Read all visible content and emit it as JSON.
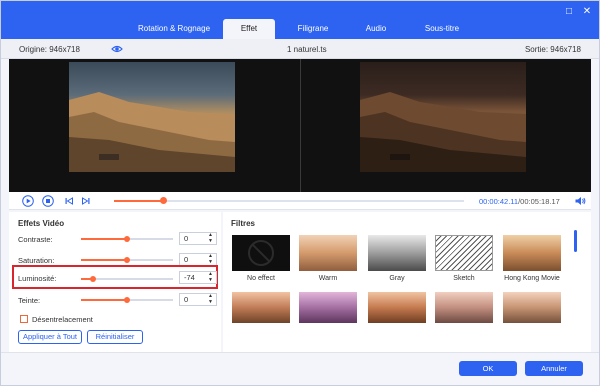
{
  "window": {
    "minimize_glyph": "□",
    "close_glyph": "✕"
  },
  "tabs": [
    {
      "label": "Rotation & Rognage",
      "active": false
    },
    {
      "label": "Effet",
      "active": true
    },
    {
      "label": "Filigrane",
      "active": false
    },
    {
      "label": "Audio",
      "active": false
    },
    {
      "label": "Sous-titre",
      "active": false
    }
  ],
  "infobar": {
    "source": "Origine: 946x718",
    "filename": "1 naturel.ts",
    "output": "Sortie: 946x718"
  },
  "playback": {
    "current_time": "00:00:42.11",
    "separator": "/",
    "total_time": "00:05:18.17",
    "progress_fraction": 0.14
  },
  "video_effects": {
    "title": "Effets Vidéo",
    "rows": [
      {
        "label": "Contraste:",
        "value": "0",
        "level": 0.5
      },
      {
        "label": "Saturation:",
        "value": "0",
        "level": 0.5
      },
      {
        "label": "Luminosité:",
        "value": "-74",
        "level": 0.13
      },
      {
        "label": "Teinte:",
        "value": "0",
        "level": 0.5
      }
    ],
    "deinterlace_label": "Désentrelacement",
    "apply_all_label": "Appliquer à Tout",
    "reset_label": "Réinitialiser"
  },
  "filters": {
    "title": "Filtres",
    "row1": [
      {
        "label": "No effect",
        "icon": "no-effect-icon"
      },
      {
        "label": "Warm"
      },
      {
        "label": "Gray"
      },
      {
        "label": "Sketch"
      },
      {
        "label": "Hong Kong Movie"
      }
    ]
  },
  "footer": {
    "ok_label": "OK",
    "cancel_label": "Annuler"
  },
  "colors": {
    "accent": "#2d63f0",
    "slider": "#ff6a3d",
    "highlight": "#d8252e"
  }
}
